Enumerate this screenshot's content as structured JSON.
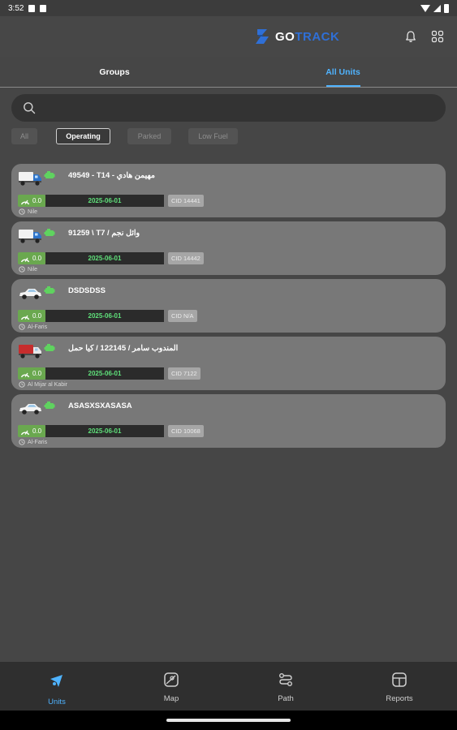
{
  "status_bar": {
    "time": "3:52"
  },
  "header": {
    "logo_go": "GO",
    "logo_track": "TRACK",
    "icons": {
      "notifications": "bell-icon",
      "apps": "grid-icon"
    }
  },
  "tabs": [
    {
      "label": "Groups",
      "active": false
    },
    {
      "label": "All Units",
      "active": true
    }
  ],
  "search": {
    "placeholder": "",
    "value": ""
  },
  "filters": [
    {
      "label": "All",
      "active": false
    },
    {
      "label": "Operating",
      "active": true
    },
    {
      "label": "Parked",
      "active": false
    },
    {
      "label": "Low Fuel",
      "active": false
    }
  ],
  "units": [
    {
      "name": "49549 - T14 - مهيمن هادي",
      "speed": "0.0",
      "date": "2025-06-01",
      "cid": "CID 14441",
      "location": "Nile",
      "vehicle": "truck-blue-icon"
    },
    {
      "name": "91259 \\ T7 / وائل نجم",
      "speed": "0.0",
      "date": "2025-06-01",
      "cid": "CID 14442",
      "location": "Nile",
      "vehicle": "truck-blue-icon"
    },
    {
      "name": "DSDSDSS",
      "speed": "0.0",
      "date": "2025-06-01",
      "cid": "CID N/A",
      "location": "Al-Faris",
      "vehicle": "car-white-icon"
    },
    {
      "name": "المندوب سامر / 122145 / كيا حمل",
      "speed": "0.0",
      "date": "2025-06-01",
      "cid": "CID 7122",
      "location": "Al Mijar al Kabir",
      "vehicle": "truck-red-icon"
    },
    {
      "name": "ASASXSXASASA",
      "speed": "0.0",
      "date": "2025-06-01",
      "cid": "CID 10068",
      "location": "Al-Faris",
      "vehicle": "car-white-icon"
    }
  ],
  "colors": {
    "accent": "#4fb3ff",
    "date_text": "#5fe07a",
    "engine_on": "#5fd35f",
    "speed_badge": "#6aa84f",
    "background": "#464646",
    "card": "#787878"
  },
  "bottom_nav": [
    {
      "label": "Units",
      "icon": "units-icon",
      "active": true
    },
    {
      "label": "Map",
      "icon": "map-icon",
      "active": false
    },
    {
      "label": "Path",
      "icon": "path-icon",
      "active": false
    },
    {
      "label": "Reports",
      "icon": "reports-icon",
      "active": false
    }
  ]
}
